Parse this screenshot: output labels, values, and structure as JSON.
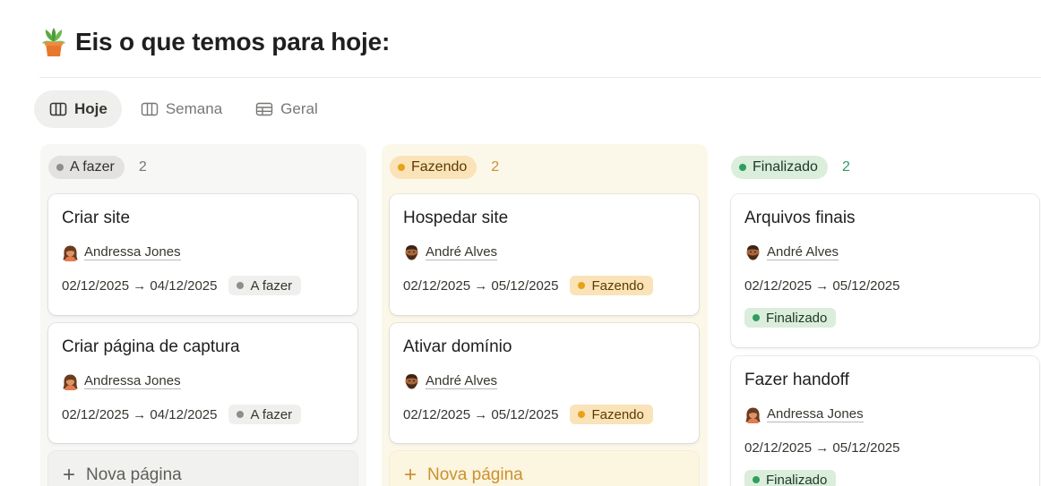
{
  "page": {
    "title": "Eis o que temos para hoje:",
    "icon": "potted-plant-icon"
  },
  "tabs": [
    {
      "label": "Hoje",
      "icon": "board-icon",
      "active": true
    },
    {
      "label": "Semana",
      "icon": "board-icon",
      "active": false
    },
    {
      "label": "Geral",
      "icon": "table-icon",
      "active": false
    }
  ],
  "columns": {
    "todo": {
      "label": "A fazer",
      "count": "2",
      "color": "#8f8e8a",
      "cards": [
        {
          "title": "Criar site",
          "person": "Andressa Jones",
          "dates": "02/12/2025 → 04/12/2025",
          "status": "A fazer"
        },
        {
          "title": "Criar página de captura",
          "person": "Andressa Jones",
          "dates": "02/12/2025 → 04/12/2025",
          "status": "A fazer"
        }
      ],
      "new_page": "Nova página"
    },
    "doing": {
      "label": "Fazendo",
      "count": "2",
      "color": "#e8a21a",
      "cards": [
        {
          "title": "Hospedar site",
          "person": "André Alves",
          "dates": "02/12/2025 → 05/12/2025",
          "status": "Fazendo"
        },
        {
          "title": "Ativar domínio",
          "person": "André Alves",
          "dates": "02/12/2025 → 05/12/2025",
          "status": "Fazendo"
        }
      ],
      "new_page": "Nova página"
    },
    "done": {
      "label": "Finalizado",
      "count": "2",
      "color": "#2e9e5f",
      "cards": [
        {
          "title": "Arquivos finais",
          "person": "André Alves",
          "dates": "02/12/2025 → 05/12/2025",
          "status": "Finalizado"
        },
        {
          "title": "Fazer handoff",
          "person": "Andressa Jones",
          "dates": "02/12/2025 → 05/12/2025",
          "status": "Finalizado"
        }
      ]
    }
  }
}
